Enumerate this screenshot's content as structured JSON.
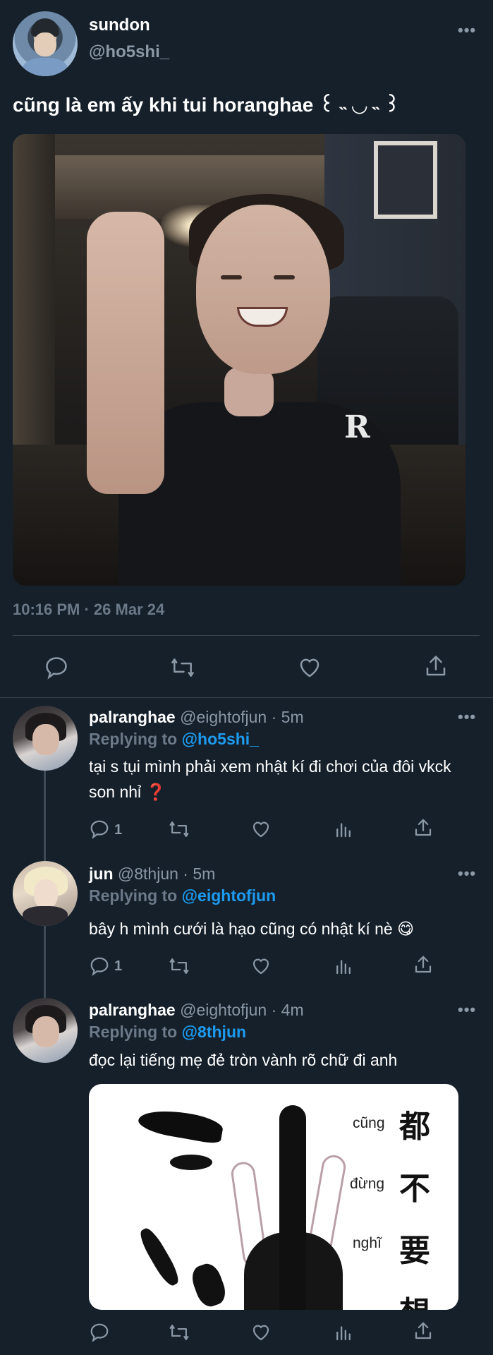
{
  "tweet": {
    "author_name": "sundon",
    "author_handle": "@ho5shi_",
    "more_label": "•••",
    "text": "cũng là em ấy khi tui horanghae ꒰ ˵ ◡ ˵ ꒱",
    "timestamp": "10:16 PM · 26 Mar 24",
    "photo_description_icon": "photo",
    "photo_logo_text": "R",
    "actions": [
      "reply-icon",
      "retweet-icon",
      "like-icon",
      "share-icon"
    ]
  },
  "replies": [
    {
      "display_name": "palranghae",
      "handle": "@eightofjun",
      "time": "5m",
      "replying_prefix": "Replying to ",
      "replying_to": "@ho5shi_",
      "text": "tại s tụi mình phải xem nhật kí đi chơi của đôi vkck son nhỉ",
      "emoji": "❓",
      "reply_count": "1"
    },
    {
      "display_name": "jun",
      "handle": "@8thjun",
      "time": "5m",
      "replying_prefix": "Replying to ",
      "replying_to": "@eightofjun",
      "text": "bây h mình cưới là hạo cũng có nhật kí nè",
      "emoji": "😋",
      "reply_count": "1"
    },
    {
      "display_name": "palranghae",
      "handle": "@eightofjun",
      "time": "4m",
      "replying_prefix": "Replying to ",
      "replying_to": "@8thjun",
      "text": "đọc lại tiếng mẹ đẻ tròn vành rõ chữ đi anh",
      "reply_count": ""
    }
  ],
  "meme": {
    "lines_vn": [
      "cũng",
      "đừng",
      "nghĩ"
    ],
    "lines_cn": [
      "都",
      "不",
      "要",
      "想"
    ]
  },
  "colors": {
    "background": "#15202b",
    "link": "#1d9bf0",
    "secondary": "#8b98a5",
    "divider": "#38444d"
  }
}
